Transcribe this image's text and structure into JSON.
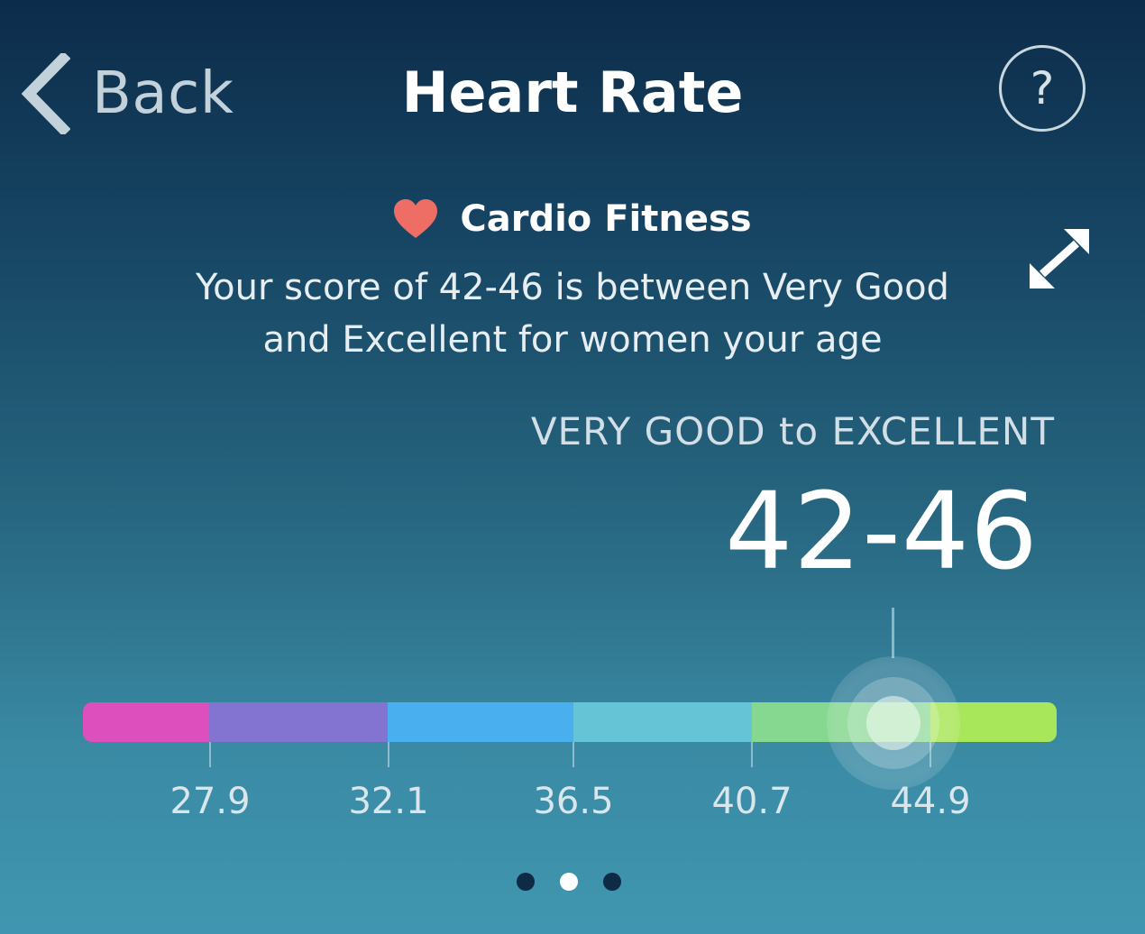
{
  "header": {
    "back_label": "Back",
    "title": "Heart Rate",
    "help_label": "?"
  },
  "cardio": {
    "title": "Cardio Fitness",
    "description_line1": "Your score of 42-46 is between Very Good",
    "description_line2": "and Excellent for women your age"
  },
  "score": {
    "rating": "VERY GOOD to EXCELLENT",
    "value": "42-46"
  },
  "gauge": {
    "segment_colors": [
      "#dc4fbd",
      "#8474d2",
      "#4aafef",
      "#65c5d6",
      "#86d790",
      "#a8e65a"
    ],
    "ticks": [
      "27.9",
      "32.1",
      "36.5",
      "40.7",
      "44.9"
    ],
    "score_position_fraction": 0.833
  },
  "pager": {
    "page_count": 3,
    "active_index": 1
  },
  "colors": {
    "heart": "#ee6e66",
    "dot_active": "#ffffff",
    "dot_inactive": "#0d2b44"
  },
  "icons": {
    "back": "chevron-left-icon",
    "help": "question-circle-icon",
    "heart": "heart-icon",
    "expand": "expand-arrows-icon"
  }
}
